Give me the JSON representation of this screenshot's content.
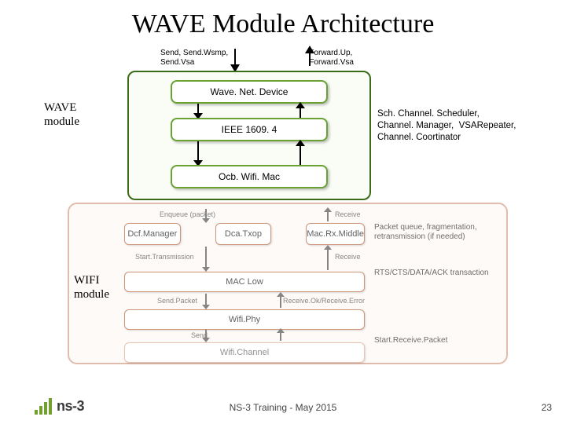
{
  "title": "WAVE Module Architecture",
  "io": {
    "send": "Send, Send.Wsmp,\nSend.Vsa",
    "forward": "Forward.Up,\nForward.Vsa"
  },
  "wave": {
    "label": "WAVE\nmodule",
    "boxes": {
      "net_device": "Wave. Net. Device",
      "ieee1609": "IEEE 1609. 4",
      "ocb": "Ocb. Wifi. Mac"
    },
    "note": "Sch. Channel. Scheduler,\nChannel. Manager,  VSARepeater,\nChannel. Coortinator"
  },
  "wifi": {
    "label": "WIFI\nmodule",
    "top": {
      "dcf": "Dcf.Manager",
      "dca": "Dca.Txop",
      "rxmid": "Mac.Rx.Middle"
    },
    "maclow": "MAC Low",
    "wifiphy": "Wifi.Phy",
    "channel": "Wifi.Channel",
    "labels": {
      "enqueue": "Enqueue (packet)",
      "receive_top": "Receive",
      "start_tx": "Start.Transmission",
      "receive_mid": "Receive",
      "send_packet": "Send.Packet",
      "receive_phy": "Receive.Ok/Receive.Error",
      "send_chan": "Send",
      "start_rx": "Start.Receive.Packet"
    },
    "notes": {
      "queue": "Packet queue, fragmentation,\nretransmission (if needed)",
      "rts": "RTS/CTS/DATA/ACK transaction"
    }
  },
  "footer": {
    "center": "NS-3 Training - May 2015",
    "page": "23",
    "logo_text": "ns-3"
  }
}
